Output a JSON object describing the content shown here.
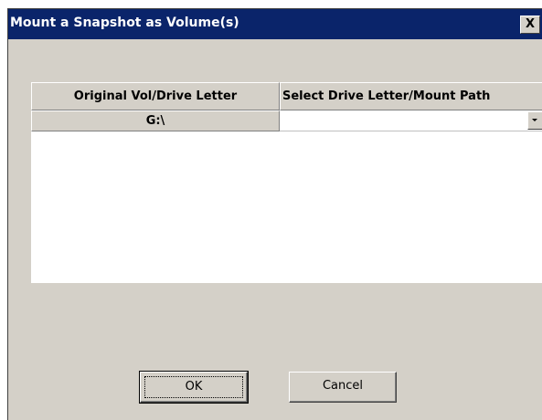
{
  "window": {
    "title": "Mount a Snapshot as Volume(s)",
    "close_label": "X"
  },
  "grid": {
    "columns": [
      "Original Vol/Drive Letter",
      "Select Drive Letter/Mount Path"
    ],
    "rows": [
      {
        "original": "G:\\",
        "mount_path": ""
      }
    ]
  },
  "buttons": {
    "ok_label": "OK",
    "cancel_label": "Cancel"
  },
  "colors": {
    "titlebar": "#0a246a",
    "dialog_face": "#d4d0c8"
  }
}
